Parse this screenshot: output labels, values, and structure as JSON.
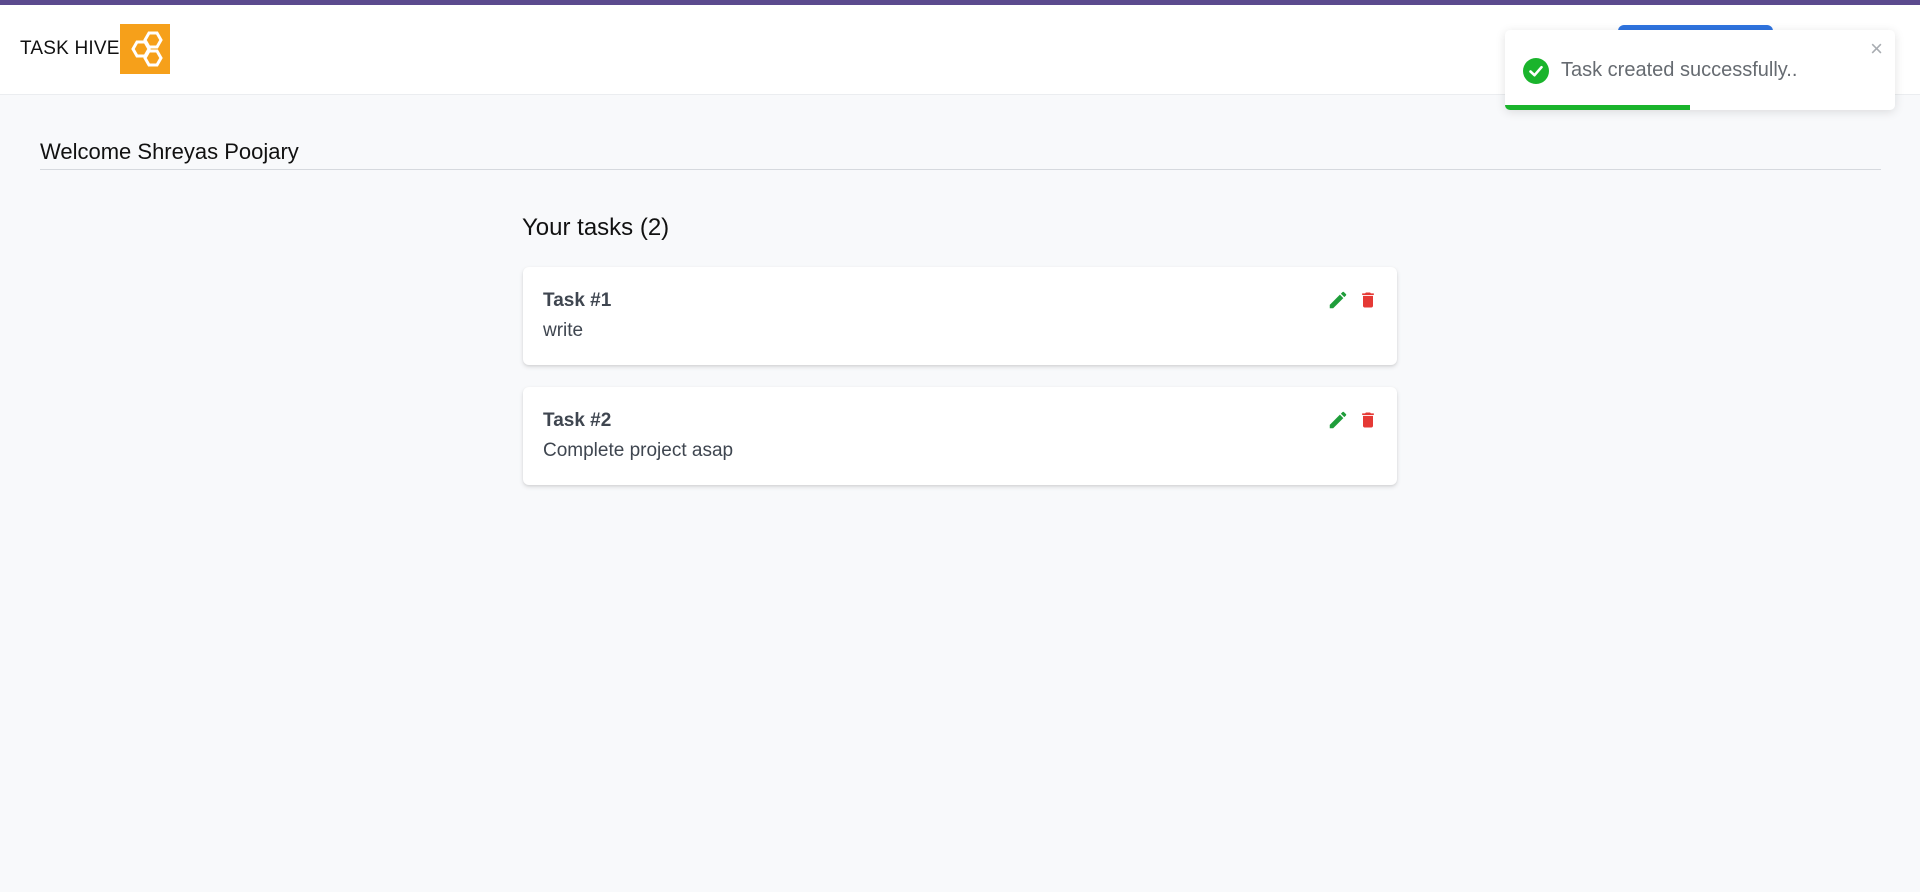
{
  "navbar": {
    "brand_text": "TASK HIVE",
    "logo_icon": "hexagon-honeycomb-icon",
    "accent_color": "#f6a01a",
    "button_color": "#2f74e0"
  },
  "main": {
    "welcome": "Welcome Shreyas Poojary",
    "tasks_heading": "Your tasks (2)",
    "tasks": [
      {
        "title": "Task #1",
        "description": "write"
      },
      {
        "title": "Task #2",
        "description": "Complete project asap"
      }
    ],
    "edit_icon": "pencil-icon",
    "delete_icon": "trash-icon",
    "edit_color": "#1f9d3a",
    "delete_color": "#e53935"
  },
  "toast": {
    "message": "Task created successfully..",
    "close_glyph": "×",
    "status_icon": "check-circle-icon",
    "status_color": "#1ab42c",
    "progress_fraction": 0.475
  }
}
